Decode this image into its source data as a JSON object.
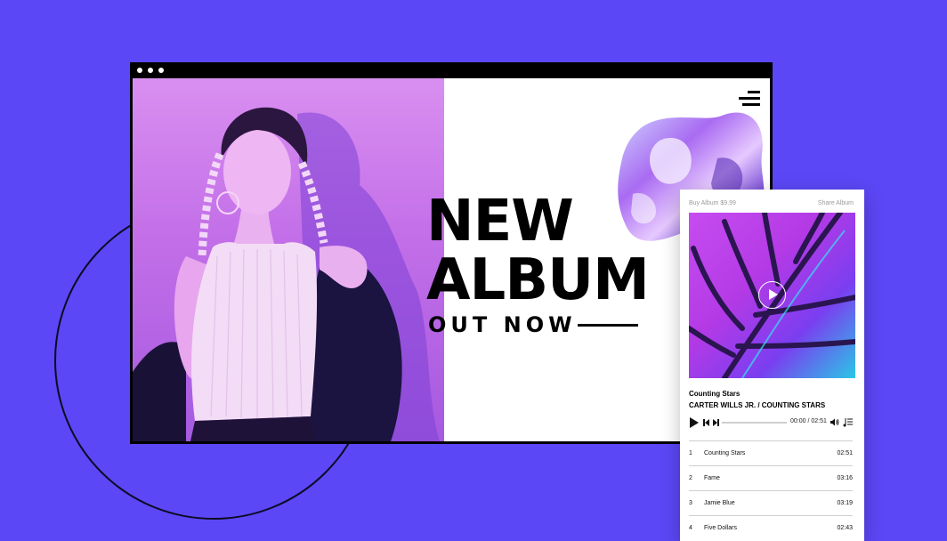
{
  "hero": {
    "headline_line1": "NEW",
    "headline_line2": "ALBUM",
    "subline": "OUT NOW"
  },
  "player": {
    "buy_label": "Buy Album $9.99",
    "share_label": "Share Album",
    "track_title": "Counting Stars",
    "artist_line": "CARTER WILLS JR. / COUNTING STARS",
    "time": "00:00 / 02:51",
    "progress": 0,
    "tracks": [
      {
        "num": "1",
        "title": "Counting Stars",
        "duration": "02:51"
      },
      {
        "num": "2",
        "title": "Fame",
        "duration": "03:16"
      },
      {
        "num": "3",
        "title": "Jamie Blue",
        "duration": "03:19"
      },
      {
        "num": "4",
        "title": "Five Dollars",
        "duration": "02:43"
      }
    ]
  },
  "icons": {
    "menu": "hamburger-icon",
    "cover_play": "play-circle-icon",
    "play": "play-icon",
    "prev": "skip-previous-icon",
    "next": "skip-next-icon",
    "volume": "volume-icon",
    "playlist": "playlist-icon"
  },
  "colors": {
    "background": "#5b47f5",
    "photo_tint": "#c26ee8",
    "cover_pink": "#c64cf0",
    "cover_cyan": "#2ac7e6",
    "text": "#000000"
  }
}
